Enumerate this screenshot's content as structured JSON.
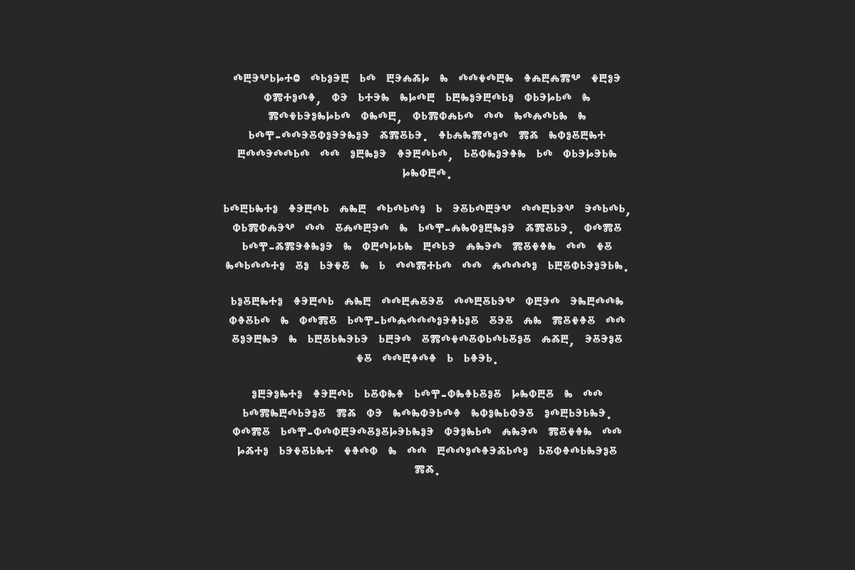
{
  "paragraphs": [
    "ⰴⰱⰵⰲⱃⱈⰰⱉ ⰴⱃⱁⰵⰱ ⱃⰴ ⰱⰵⰾⰶⱈ ⰸ ⰴⰴⰷⰴⰱⰸ ⱖⰾⰱⰾⰿⰲ ⰷⰱⱁⰵ\nⱇⰿⰰⱁⰴⱖ, ⱇⰵ ⱃⰰⰵⰸ ⰸⱈⰴⰱ ⱃⰱⰸⱁⰵⰱⰴⱃⱁ ⱇⱃⰵⱈⱃⰴ ⰸ\nⰿⰴⰷⱃⰵⱁⰸⱈⱃⰴ ⱇⰸⰴⰱ, ⱇⱃⰿⱇⰾⱃⰴ ⰴⰴ ⰸⰴⰾⰴⱃⰸ ⰸ\nⱃⰴⰹ-ⰴⰴⰵⰻⱇⱁⰵⰵⰸⱁⰵ ⰶⰿⰻⱃⰵ. ⱖⱃⰾⰸⰿⰴⱁⰴ ⰿⰶ ⰸⱇⱁⰻⰱⰸⰰ\nⰱⰴⰴⰵⰴⰴⱃⰴ ⰴⰴ ⱁⰱⰸⱁⰵ ⱖⰵⰱⰴⱃⰴ, ⱃⰻⱇⰸⱁⰵⱖⰸ ⱃⰴ ⱇⱃⰵⱈⰵⱃⰸ\nⱈⰸⱇⰱⰴ.",
    "ⱃⰴⰱⱃⰸⰰⱁ ⱖⰵⰱⰴⱃ ⰾⰸⰱ ⰴⱃⰴⱃⰴⱁ ⱃ ⰵⰻⱃⰴⰱⰵⰲ ⰴⰴⰱⱃⰵⰲ ⰵⰴⱃⰴⱃ,\nⱇⱃⰿⱇⰾⰵⰲ ⰴⰴ ⰻⰾⰴⰱⰵⰴ ⰸ ⱃⰴⰹ-ⰾⰸⱇⱁⰱⰸⱁⰵ ⰶⰿⰻⱃⰵ. ⱇⰴⰿⰻ\nⱃⰴⰹ-ⰶⰿⰵⱖⰸⱁⰵ ⰸ ⱇⰱⰴⱈⱃⰸ ⰱⰴⱃⰵ ⰾⰸⰵⰴ ⰿⰻⰷⱖⰸ ⰴⰴ ⰷⰻ\nⰸⰴⱃⰴⰴⰰⱁ ⰻⱁ ⱃⰵⰷⰻ ⰸ ⱃ ⰴⰴⰿⰰⱃⰴ ⰴⰴ ⰾⰴⰴⰴⱁ ⱃⰱⰻⱇⱃⰵⱁⰵⱃⰸ.",
    "ⱃⱁⰻⰱⰸⰰⱁ ⱖⰵⰱⰴⱃ ⰾⰸⰱ ⰴⰴⰱⰾⰻⰵⰻ ⰴⰴⰱⰻⱃⰵⰲ ⱇⰱⰵⰴ ⰵⰸⰱⰴⰴⰸ\nⱇⱖⰻⱃⰴ ⰸ ⱇⰴⰿⰻ ⱃⰴⰹ-ⱃⰴⰾⰴⰴⰴⱁⰵⱖⱃⱁⰻ ⰻⰵⰻ ⰾⰸ ⰿⰻⰷⱖⰻ ⰴⰴ\nⰻⱁⰵⰱⰸⰵ ⰸ ⱃⰱⰻⱃⰸⰵⱃⰵ ⱃⰱⰵⰴ ⰻⰿⰴⰷⰴⰻⱇⱃⰴⱃⰻⱁⰻ ⰾⰶⰱ, ⰵⰻⰵⱁⰻ\nⰷⰻ ⰴⰴⰱⱖⰴⱖ ⱃ ⱃⱖⰵⱃ.",
    "ⱁⰱⰵⱁⰸⰰⱁ ⱖⰵⰱⰴⱃ ⱃⰻⱇⰸⱖ ⱃⰴⰹ-ⱇⰸⱖⱃⰻⱁⰻ ⱈⰸⱇⰱⰻ ⰸ ⰴⰴ\nⱃⰴⰿⰸⰱⰴⱃⰵⱁⰻ ⰿⰶ ⱇⰵ ⰸⰴⰸⱇⰵⱃⰴⱖ ⰸⱇⱁⰸⱃⱇⰵⰻ ⱁⰴⰱⱃⰵⱃⰸⰵ.\nⱇⰴⰿⰻ ⱃⰴⰹ-ⱇⰴⱇⰱⰵⰴⰻⱁⰻⱈⰵⱃⰸⱁⰵ ⱇⰵⱁⰸⱃⰴ ⰾⰸⰵⰴ ⰿⰻⰷⱖⰸ ⰴⰴ\nⱈⰶⰰⱁ ⱃⰵⰷⰻⱃⰸⰰ ⰷⱖⰴⱇ ⰸ ⰴⰴ ⰱⰴⰴⱁⰴⱖⰵⰶⱃⰴⱁ ⱃⰻⱇⱖⰴⱃⰸⰵⱁⰻ\nⰿⰶ."
  ]
}
